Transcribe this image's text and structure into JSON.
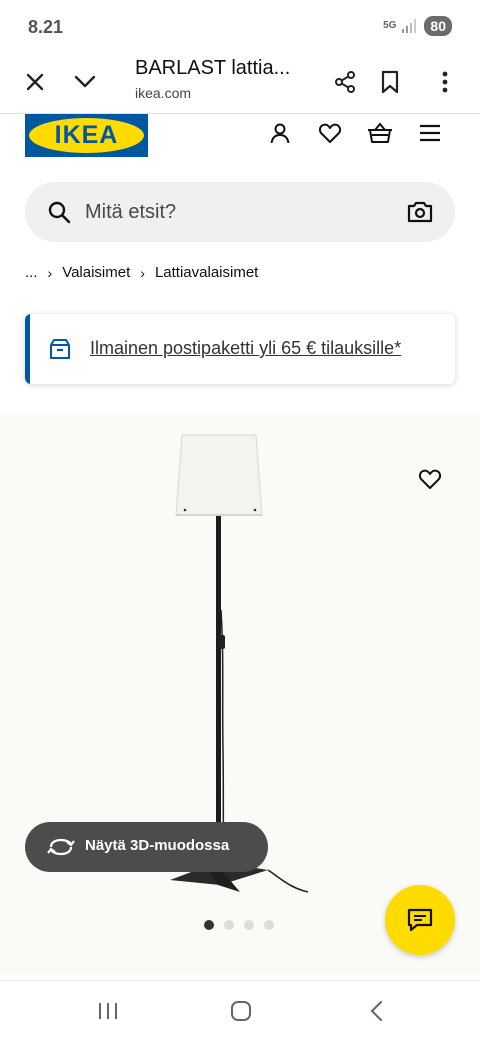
{
  "status_bar": {
    "time": "8.21",
    "network": "5G",
    "battery": "80"
  },
  "browser": {
    "title": "BARLAST lattia...",
    "url": "ikea.com"
  },
  "header": {
    "logo_text": "IKEA",
    "icons": [
      "profile-icon",
      "favourites-icon",
      "cart-icon",
      "menu-icon"
    ]
  },
  "search": {
    "placeholder": "Mitä etsit?"
  },
  "breadcrumb": {
    "ellipsis": "...",
    "items": [
      "Valaisimet",
      "Lattiavalaisimet"
    ]
  },
  "banner": {
    "text": "Ilmainen postipaketti yli 65 € tilauksille*",
    "accent": "#0058a3"
  },
  "product": {
    "view_3d_label": "Näytä 3D-muodossa",
    "image_count": 4,
    "active_image": 1
  },
  "colors": {
    "ikea_blue": "#0058a3",
    "ikea_yellow": "#ffdb00",
    "dark_button": "#4c4c4c"
  }
}
